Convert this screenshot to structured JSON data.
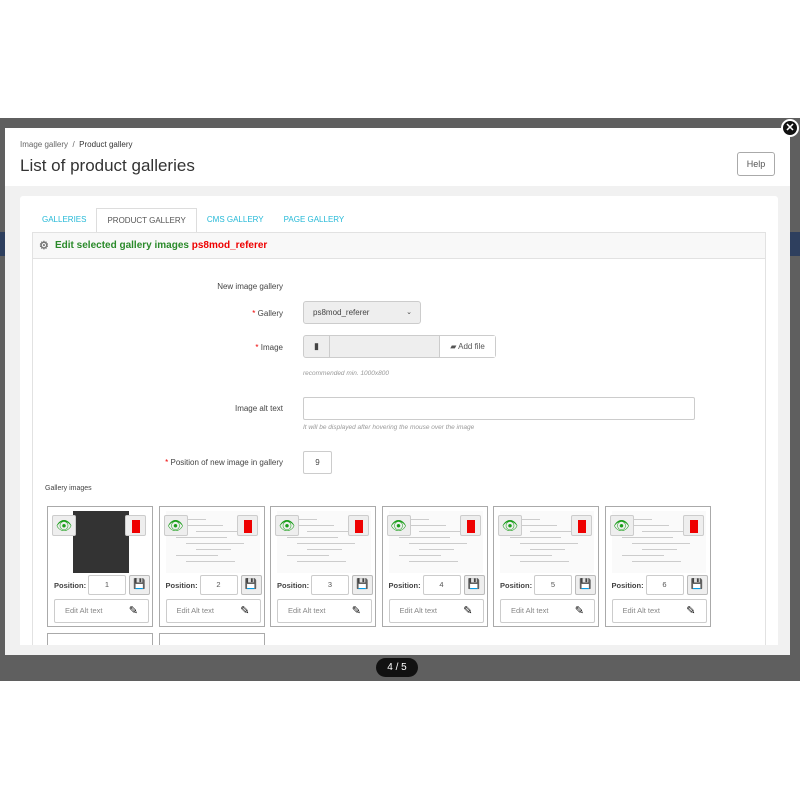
{
  "counter": "4 / 5",
  "close_icon": "close-icon",
  "breadcrumb": {
    "parent": "Image gallery",
    "separator": "/",
    "current": "Product gallery"
  },
  "page_title": "List of product galleries",
  "help_label": "Help",
  "tabs": [
    {
      "label": "GALLERIES"
    },
    {
      "label": "PRODUCT GALLERY",
      "active": true
    },
    {
      "label": "CMS GALLERY"
    },
    {
      "label": "PAGE GALLERY"
    }
  ],
  "panel": {
    "title": "Edit selected gallery images",
    "gallery_name": "ps8mod_referer"
  },
  "form": {
    "section_label": "New image gallery",
    "gallery_label": "Gallery",
    "gallery_value": "ps8mod_referer",
    "image_label": "Image",
    "add_file": "Add file",
    "image_hint": "recommended min. 1000x800",
    "alt_label": "Image alt text",
    "alt_value": "",
    "alt_hint": "It will be displayed after hovering the mouse over the image",
    "position_label": "Position of new image in gallery",
    "position_value": "9",
    "required_mark": "*"
  },
  "gallery": {
    "label": "Gallery images",
    "position_label": "Position:",
    "edit_label": "Edit Alt text",
    "items": [
      {
        "position": "1"
      },
      {
        "position": "2"
      },
      {
        "position": "3"
      },
      {
        "position": "4"
      },
      {
        "position": "5"
      },
      {
        "position": "6"
      }
    ]
  },
  "colors": {
    "accent": "#25b9d7",
    "title_green": "#2a8a2a",
    "gallery_red": "#e00000"
  }
}
